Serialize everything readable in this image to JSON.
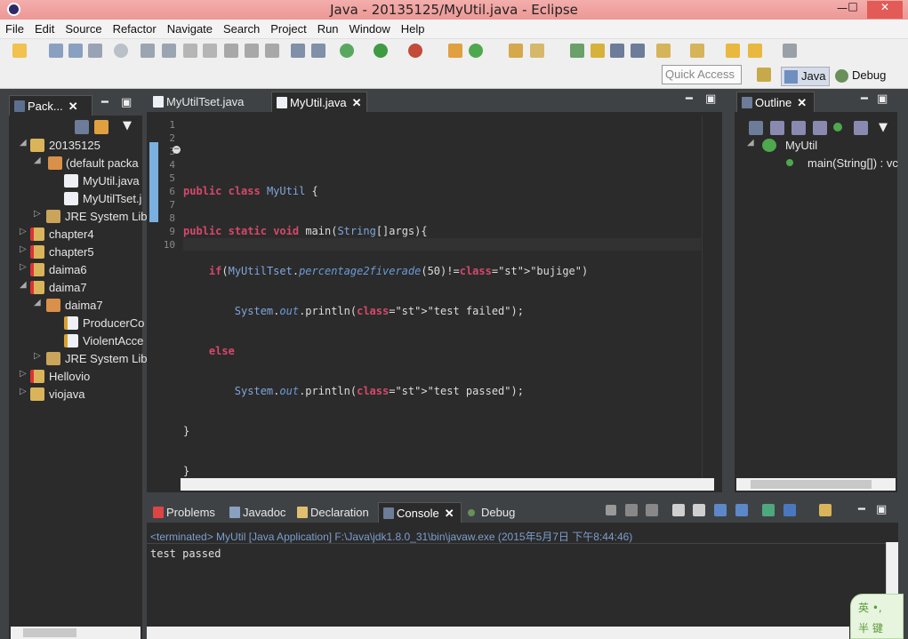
{
  "window": {
    "title": "Java - 20135125/MyUtil.java - Eclipse",
    "minimize": "—",
    "maximize": "□",
    "close": "✕"
  },
  "menu": [
    "File",
    "Edit",
    "Source",
    "Refactor",
    "Navigate",
    "Search",
    "Project",
    "Run",
    "Window",
    "Help"
  ],
  "quick_access": {
    "placeholder": "Quick Access"
  },
  "perspectives": [
    {
      "label": "Java",
      "icon": "java-perspective-icon"
    },
    {
      "label": "Debug",
      "icon": "debug-perspective-icon"
    }
  ],
  "package_explorer": {
    "tab_label": "Pack...",
    "items": [
      {
        "label": "20135125",
        "icon": "project-folder-icon"
      },
      {
        "label": "(default packa",
        "icon": "package-icon"
      },
      {
        "label": "MyUtil.java",
        "icon": "java-file-icon"
      },
      {
        "label": "MyUtilTset.j",
        "icon": "java-file-icon"
      },
      {
        "label": "JRE System Lib",
        "icon": "library-icon"
      },
      {
        "label": "chapter4",
        "icon": "error-project-icon"
      },
      {
        "label": "chapter5",
        "icon": "error-project-icon"
      },
      {
        "label": "daima6",
        "icon": "error-project-icon"
      },
      {
        "label": "daima7",
        "icon": "error-project-icon"
      },
      {
        "label": "daima7",
        "icon": "package-icon"
      },
      {
        "label": "ProducerCo",
        "icon": "java-file-icon"
      },
      {
        "label": "ViolentAcce",
        "icon": "java-file-icon"
      },
      {
        "label": "JRE System Lib",
        "icon": "library-icon"
      },
      {
        "label": "Hellovio",
        "icon": "error-project-icon"
      },
      {
        "label": "viojava",
        "icon": "project-folder-icon"
      }
    ]
  },
  "editor": {
    "tabs": [
      {
        "label": "MyUtilTset.java"
      },
      {
        "label": "MyUtil.java"
      }
    ],
    "line_numbers": [
      "1",
      "2",
      "3",
      "4",
      "5",
      "6",
      "7",
      "8",
      "9",
      "10"
    ],
    "code_lines": [
      "",
      "public class MyUtil {",
      "public static void main(String[]args){",
      "    if(MyUtilTset.percentage2fiverade(50)!=\"bujige\")",
      "        System.out.println(\"test failed\");",
      "    else",
      "        System.out.println(\"test passed\");",
      "}",
      "}",
      ""
    ]
  },
  "outline": {
    "tab_label": "Outline",
    "items": [
      {
        "label": "MyUtil"
      },
      {
        "label": "main(String[]) : vc"
      }
    ]
  },
  "bottom": {
    "tabs": [
      {
        "label": "Problems"
      },
      {
        "label": "Javadoc"
      },
      {
        "label": "Declaration"
      },
      {
        "label": "Console"
      },
      {
        "label": "Debug"
      }
    ],
    "console_header": "<terminated> MyUtil [Java Application] F:\\Java\\jdk1.8.0_31\\bin\\javaw.exe (2015年5月7日 下午8:44:46)",
    "console_output": "test passed"
  },
  "ime_badge": {
    "line1": "英 •,",
    "line2": "半 键"
  },
  "colors": {
    "titlebar": "#f0a1a0",
    "keyword": "#d5486b",
    "string": "#e0a46a",
    "panel_bg": "#2b2b2b"
  }
}
